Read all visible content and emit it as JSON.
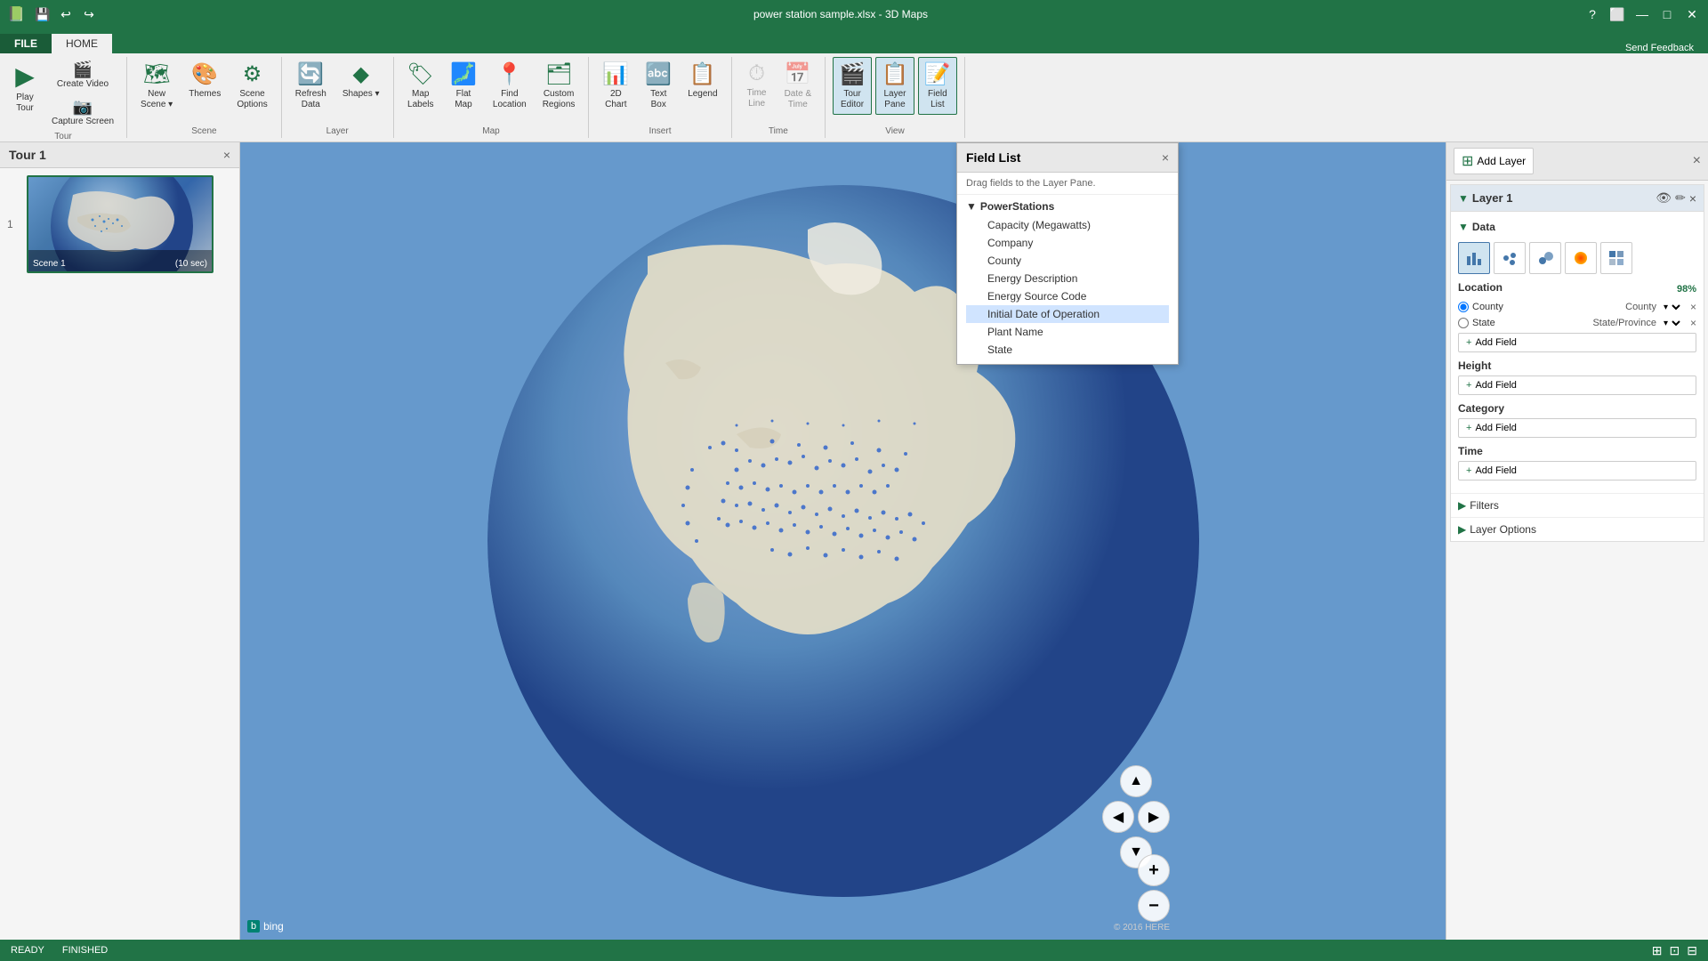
{
  "titleBar": {
    "title": "power station sample.xlsx - 3D Maps",
    "icons": [
      "undo",
      "redo",
      "save"
    ],
    "rightIcons": [
      "help",
      "ribbon-minimize",
      "minimize",
      "restore",
      "close"
    ],
    "feedbackLabel": "Send Feedback"
  },
  "ribbonTabs": [
    {
      "id": "file",
      "label": "FILE",
      "active": false
    },
    {
      "id": "home",
      "label": "HOME",
      "active": true
    }
  ],
  "ribbon": {
    "groups": [
      {
        "id": "tour",
        "label": "Tour",
        "items": [
          {
            "id": "play-tour",
            "label": "Play\nTour",
            "icon": "▶"
          },
          {
            "id": "create-video",
            "label": "Create\nVideo",
            "icon": "🎬"
          },
          {
            "id": "capture-screen",
            "label": "Capture\nScreen",
            "icon": "📷"
          }
        ]
      },
      {
        "id": "scene",
        "label": "Scene",
        "items": [
          {
            "id": "new-scene",
            "label": "New\nScene",
            "icon": "🗺"
          },
          {
            "id": "themes",
            "label": "Themes",
            "icon": "🎨"
          },
          {
            "id": "scene-options",
            "label": "Scene\nOptions",
            "icon": "⚙"
          }
        ]
      },
      {
        "id": "layer",
        "label": "Layer",
        "items": [
          {
            "id": "refresh-data",
            "label": "Refresh\nData",
            "icon": "🔄"
          },
          {
            "id": "shapes",
            "label": "Shapes",
            "icon": "◆"
          }
        ]
      },
      {
        "id": "map",
        "label": "Map",
        "items": [
          {
            "id": "map-labels",
            "label": "Map\nLabels",
            "icon": "🏷"
          },
          {
            "id": "flat-map",
            "label": "Flat\nMap",
            "icon": "🗾"
          },
          {
            "id": "find-location",
            "label": "Find\nLocation",
            "icon": "📍"
          },
          {
            "id": "custom-regions",
            "label": "Custom\nRegions",
            "icon": "🗂"
          }
        ]
      },
      {
        "id": "insert",
        "label": "Insert",
        "items": [
          {
            "id": "2d-chart",
            "label": "2D\nChart",
            "icon": "📊"
          },
          {
            "id": "text-box",
            "label": "Text\nBox",
            "icon": "🔤"
          },
          {
            "id": "legend",
            "label": "Legend",
            "icon": "📋"
          }
        ]
      },
      {
        "id": "time",
        "label": "Time",
        "items": [
          {
            "id": "time-line",
            "label": "Time\nLine",
            "icon": "⏱",
            "disabled": true
          },
          {
            "id": "date-time",
            "label": "Date &\nTime",
            "icon": "📅",
            "disabled": true
          }
        ]
      },
      {
        "id": "view",
        "label": "View",
        "items": [
          {
            "id": "tour-editor",
            "label": "Tour\nEditor",
            "icon": "🎬",
            "active": true
          },
          {
            "id": "layer-pane",
            "label": "Layer\nPane",
            "icon": "📋",
            "active": true
          },
          {
            "id": "field-list",
            "label": "Field\nList",
            "icon": "📝",
            "active": true
          }
        ]
      }
    ]
  },
  "tourPanel": {
    "title": "Tour 1",
    "closeLabel": "×",
    "scenes": [
      {
        "number": "1",
        "name": "Scene 1",
        "duration": "(10 sec)"
      }
    ]
  },
  "fieldList": {
    "title": "Field List",
    "subtitle": "Drag fields to the Layer Pane.",
    "closeLabel": "×",
    "groups": [
      {
        "name": "PowerStations",
        "fields": [
          "Capacity (Megawatts)",
          "Company",
          "County",
          "Energy Description",
          "Energy Source Code",
          "Initial Date of Operation",
          "Plant Name",
          "State"
        ]
      }
    ]
  },
  "layerPanel": {
    "addLayerLabel": "Add Layer",
    "layers": [
      {
        "name": "Layer 1",
        "data": {
          "sectionLabel": "Data",
          "vizTypes": [
            "bar",
            "cluster",
            "bubble",
            "heat",
            "region"
          ],
          "location": {
            "label": "Location",
            "badge": "98%",
            "fields": [
              {
                "name": "County",
                "map": "County",
                "type": "radio-checked"
              },
              {
                "name": "State",
                "map": "State/Province",
                "type": "radio"
              }
            ],
            "addFieldLabel": "+ Add Field"
          },
          "height": {
            "label": "Height",
            "addFieldLabel": "+ Add Field"
          },
          "category": {
            "label": "Category",
            "addFieldLabel": "+ Add Field"
          },
          "time": {
            "label": "Time",
            "addFieldLabel": "+ Add Field"
          }
        },
        "filters": {
          "label": "Filters",
          "collapsed": true
        },
        "layerOptions": {
          "label": "Layer Options",
          "collapsed": true
        }
      }
    ]
  },
  "mapNav": {
    "upIcon": "▲",
    "leftIcon": "◀",
    "rightIcon": "▶",
    "downIcon": "▼"
  },
  "statusBar": {
    "ready": "READY",
    "finished": "FINISHED"
  },
  "bing": {
    "logo": "⊙ bing",
    "copyright": "© 2016 HERE"
  }
}
